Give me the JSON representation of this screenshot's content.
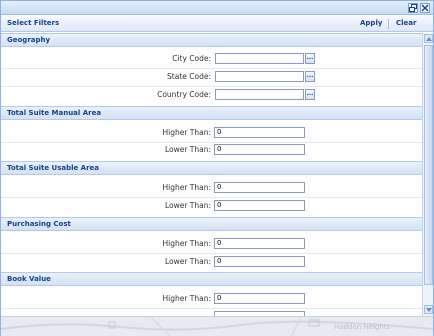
{
  "toolbar": {
    "title": "Select Filters",
    "apply_label": "Apply",
    "clear_label": "Clear"
  },
  "window_buttons": [
    "restore-icon",
    "close-icon"
  ],
  "sections": [
    {
      "title": "Geography",
      "fields": [
        {
          "label": "City Code:",
          "value": "",
          "picker": "..."
        },
        {
          "label": "State Code:",
          "value": "",
          "picker": "..."
        },
        {
          "label": "Country Code:",
          "value": "",
          "picker": "..."
        }
      ]
    },
    {
      "title": "Total Suite Manual Area",
      "fields": [
        {
          "label": "Higher Than:",
          "value": "0"
        },
        {
          "label": "Lower Than:",
          "value": "0"
        }
      ]
    },
    {
      "title": "Total Suite Usable Area",
      "fields": [
        {
          "label": "Higher Than:",
          "value": "0"
        },
        {
          "label": "Lower Than:",
          "value": "0"
        }
      ]
    },
    {
      "title": "Purchasing Cost",
      "fields": [
        {
          "label": "Higher Than:",
          "value": "0"
        },
        {
          "label": "Lower Than:",
          "value": "0"
        }
      ]
    },
    {
      "title": "Book Value",
      "fields": [
        {
          "label": "Higher Than:",
          "value": "0"
        }
      ]
    }
  ],
  "background_map": {
    "labels": [
      "Haddon Heights"
    ]
  }
}
